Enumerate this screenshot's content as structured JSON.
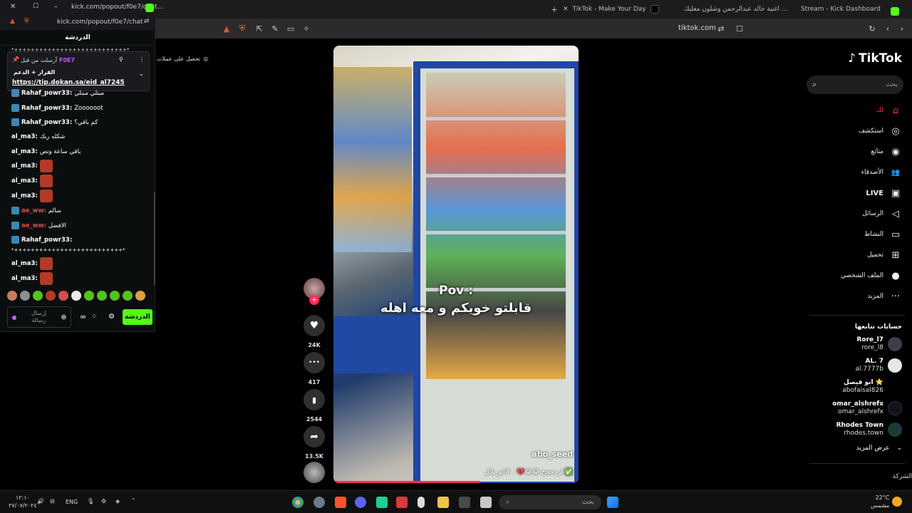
{
  "browser": {
    "tabs": [
      {
        "label": "TikTok - Make Your Day",
        "active": true
      },
      {
        "label": "اغنية خالد عبدالرحمن وشلون مغليك ...",
        "active": false
      },
      {
        "label": "Stream - Kick Dashboard",
        "active": false
      }
    ],
    "address": "tiktok.com",
    "new_tab": "+"
  },
  "kick_window": {
    "title": "kick.com/popout/f0e7/chat...",
    "address": "kick.com/popout/f0e7/chat",
    "header": "الدردشة",
    "top_line": "*+++++++++++++++++++++++++++*",
    "pinned": {
      "sender_prefix": "أرسلت من قبل",
      "sender": "F0E7",
      "title": "القرار + الدعم",
      "link": "https://tip.dokan.sa/eid_al7245"
    },
    "messages": [
      {
        "user": "Rahaf_powr33:",
        "text": "مبتلي مبتلي",
        "user_color": "#e0e0e0",
        "badge": true
      },
      {
        "user": "Rahaf_powr33:",
        "text": "Zoooooot",
        "user_color": "#e0e0e0",
        "badge": true
      },
      {
        "user": "Rahaf_powr33:",
        "text": "كم باقي؟",
        "user_color": "#e0e0e0",
        "badge": true
      },
      {
        "user": "al_ma3:",
        "text": "شكله ربك",
        "user_color": "#e0e0e0",
        "badge": false
      },
      {
        "user": "al_ma3:",
        "text": "باقي ساعة وتص",
        "user_color": "#e0e0e0",
        "badge": false
      },
      {
        "user": "al_ma3:",
        "text": "",
        "user_color": "#e0e0e0",
        "badge": false,
        "emote": true
      },
      {
        "user": "al_ma3:",
        "text": "",
        "user_color": "#e0e0e0",
        "badge": false,
        "emote": true
      },
      {
        "user": "al_ma3:",
        "text": "",
        "user_color": "#e0e0e0",
        "badge": false,
        "emote": true
      },
      {
        "user": "ae_ww:",
        "text": "سالم",
        "user_color": "#e04b4b",
        "badge": true
      },
      {
        "user": "ae_ww:",
        "text": "الافضل",
        "user_color": "#e04b4b",
        "badge": true
      },
      {
        "user": "Rahaf_powr33:",
        "text": "",
        "user_color": "#e0e0e0",
        "badge": true
      },
      {
        "user": "",
        "text": "*++++++++++++++++++++++++++*",
        "user_color": "#e0e0e0",
        "badge": false
      },
      {
        "user": "al_ma3:",
        "text": "",
        "user_color": "#e0e0e0",
        "badge": false,
        "emote": true
      },
      {
        "user": "al_ma3:",
        "text": "",
        "user_color": "#e0e0e0",
        "badge": false,
        "emote": true
      }
    ],
    "input_placeholder": "إرسال رسالة",
    "send_label": "الدردشة"
  },
  "promo_text": "تحصل على عملات",
  "video": {
    "overlay_title": "Pov :",
    "overlay_subtitle": "قابلتو خويكم و معه اهله",
    "author": "abo_seed",
    "caption": "ارحححح 😂😂💔 . #ابو_بلال ✅",
    "progress": 0.6
  },
  "actions": [
    {
      "name": "like",
      "icon": "heart-icon",
      "glyph": "♥",
      "count": "24K"
    },
    {
      "name": "comment",
      "icon": "comment-icon",
      "glyph": "•••",
      "count": "417"
    },
    {
      "name": "bookmark",
      "icon": "bookmark-icon",
      "glyph": "▮",
      "count": "2544"
    },
    {
      "name": "share",
      "icon": "share-icon",
      "glyph": "➦",
      "count": "13.5K"
    }
  ],
  "sidebar": {
    "logo": "TikTok",
    "search_placeholder": "بحث",
    "nav": [
      {
        "label": "لك",
        "icon": "home-icon",
        "glyph": "⌂"
      },
      {
        "label": "استكشف",
        "icon": "compass-icon",
        "glyph": "◎"
      },
      {
        "label": "متابَع",
        "icon": "following-icon",
        "glyph": "◉"
      },
      {
        "label": "الأصدقاء",
        "icon": "friends-icon",
        "glyph": "👥"
      },
      {
        "label": "LIVE",
        "icon": "live-icon",
        "glyph": "▣"
      },
      {
        "label": "الرسائل",
        "icon": "messages-icon",
        "glyph": "◁"
      },
      {
        "label": "النشاط",
        "icon": "activity-icon",
        "glyph": "▭"
      },
      {
        "label": "تحميل",
        "icon": "upload-icon",
        "glyph": "⊞"
      },
      {
        "label": "الملف الشخصي",
        "icon": "profile-icon",
        "glyph": "●"
      },
      {
        "label": "المزيد",
        "icon": "more-icon",
        "glyph": "···"
      }
    ],
    "following_title": "حسابات تتابعها",
    "following": [
      {
        "name": "Rore_l7",
        "handle": "rore_l8"
      },
      {
        "name": "AL. 7",
        "handle": "al.7777b"
      },
      {
        "name": "ابو فيصل ⭐",
        "handle": "abofaisal826"
      },
      {
        "name": "omar_alshrefx",
        "handle": "omar_alshrefx"
      },
      {
        "name": "Rhodes Town",
        "handle": "rhodes.town"
      }
    ],
    "see_more": "عرض المزيد",
    "company": "الشركة"
  },
  "taskbar": {
    "search_placeholder": "بحث",
    "time": "١٢:١٠",
    "date": "٢٧/٠٧/٢٠٢٤",
    "lang": "ENG",
    "weather_temp": "22°C",
    "weather_desc": "مشمس"
  },
  "colors": {
    "tiktok_red": "#fe2c55",
    "kick_green": "#53fc18"
  }
}
